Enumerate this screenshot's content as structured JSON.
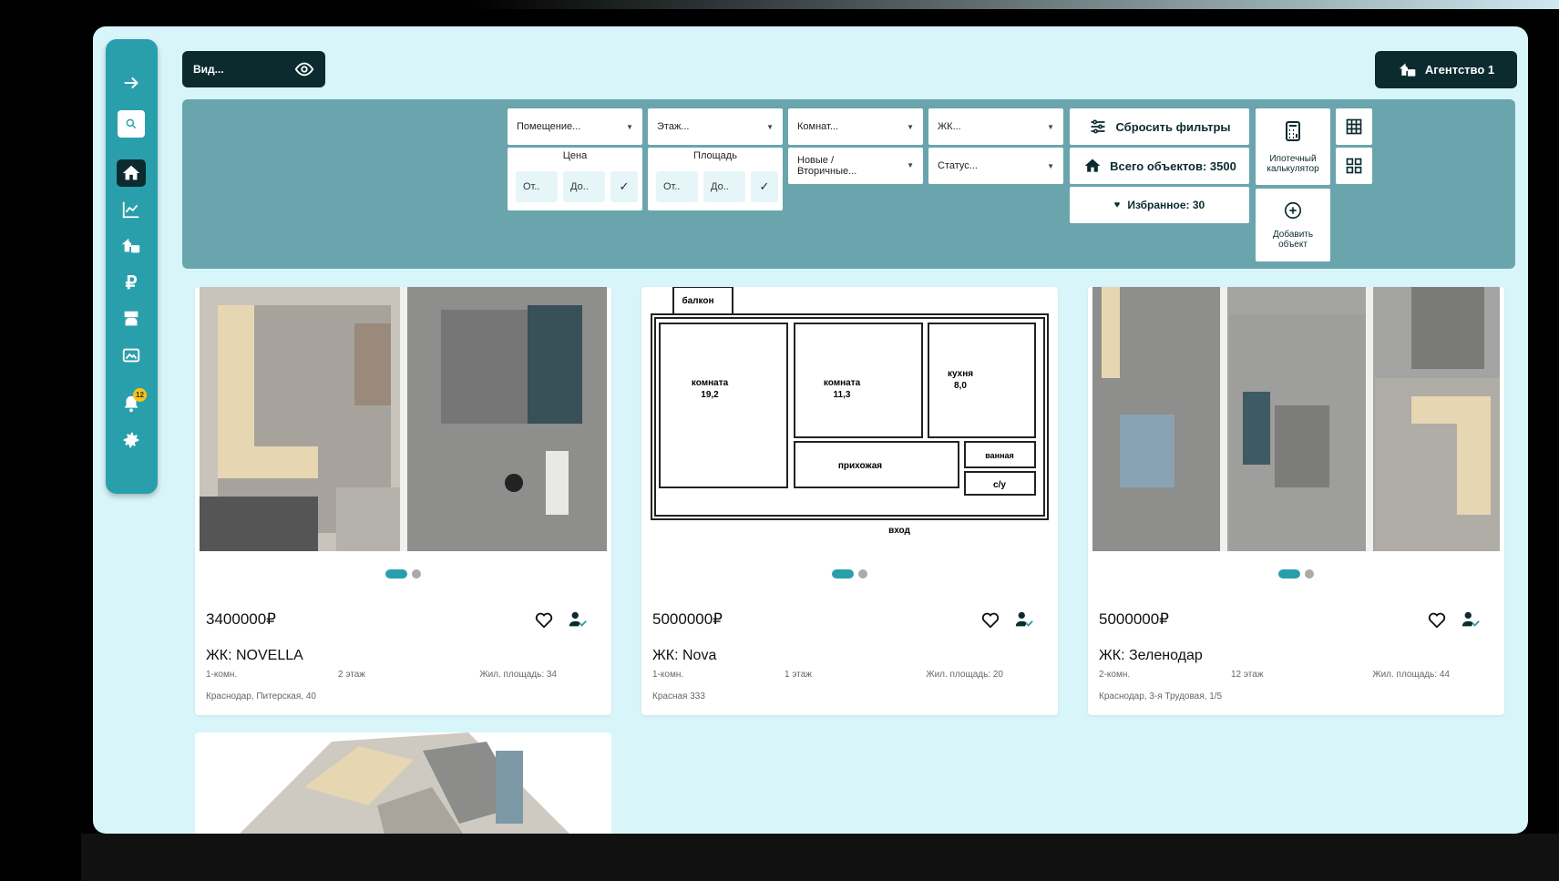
{
  "view_select": {
    "label": "Вид..."
  },
  "agency": {
    "label": "Агентство 1"
  },
  "sidebar": {
    "notifications_count": "12"
  },
  "filters": {
    "premises": "Помещение...",
    "floor": "Этаж...",
    "rooms": "Комнат...",
    "complex": "ЖК...",
    "new_secondary": "Новые / Вторичные...",
    "status": "Статус...",
    "price": {
      "title": "Цена",
      "from": "От..",
      "to": "До.."
    },
    "area": {
      "title": "Площадь",
      "from": "От..",
      "to": "До.."
    },
    "reset": "Сбросить фильтры",
    "total": "Всего объектов: 3500",
    "favorites": "Избранное: 30",
    "mortgage_calc": "Ипотечный калькулятор",
    "add_object": "Добавить объект"
  },
  "listings": [
    {
      "price": "3400000₽",
      "complex": "ЖК: NOVELLA",
      "rooms": "1-комн.",
      "floor": "2 этаж",
      "area": "Жил. площадь: 34",
      "address": "Краснодар, Питерская, 40"
    },
    {
      "price": "5000000₽",
      "complex": "ЖК: Nova",
      "rooms": "1-комн.",
      "floor": "1 этаж",
      "area": "Жил. площадь: 20",
      "address": "Красная 333",
      "plan_labels": {
        "balcony": "балкон",
        "room1": "комната",
        "room1_area": "19,2",
        "room2": "комната",
        "room2_area": "11,3",
        "kitchen": "кухня",
        "kitchen_area": "8,0",
        "bath": "ванная",
        "hall": "прихожая",
        "wc": "с/у",
        "entry": "вход"
      }
    },
    {
      "price": "5000000₽",
      "complex": "ЖК: Зеленодар",
      "rooms": "2-комн.",
      "floor": "12 этаж",
      "area": "Жил. площадь: 44",
      "address": "Краснодар, 3-я Трудовая, 1/5"
    }
  ],
  "colors": {
    "sidebar": "#2a9fac",
    "dark": "#0b2b2f",
    "panel": "#6aa5ad",
    "background": "#d8f5fa"
  }
}
